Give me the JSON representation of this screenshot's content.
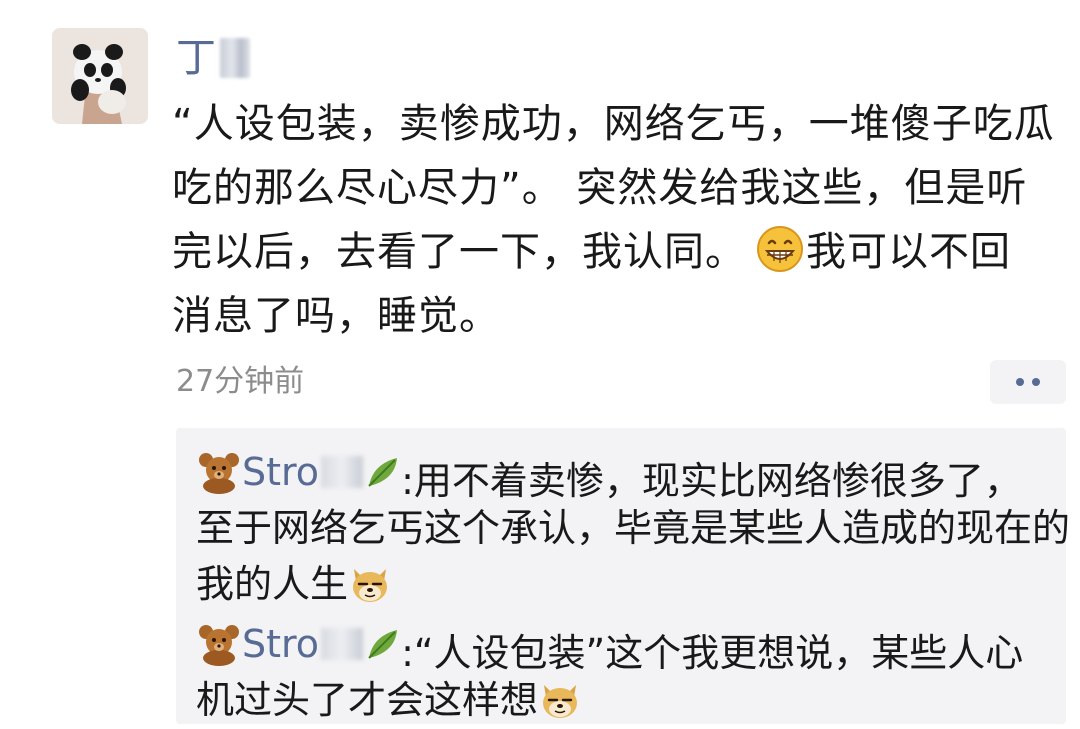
{
  "post": {
    "author": "丁",
    "lines": [
      "“人设包装，卖惨成功，网络乞丐，一堆傻子吃瓜",
      "吃的那么尽心尽力”。 突然发给我这些，但是听",
      "完以后，去看了一下，我认同。",
      "我可以不回",
      "消息了吗，睡觉。"
    ],
    "timestamp": "27分钟前",
    "avatar_icon": "panda-avatar-icon",
    "inline_emoji": "grin-emoji-icon"
  },
  "comments": [
    {
      "author": "Stro",
      "separator": ":",
      "lines": [
        "用不着卖惨，现实比网络惨很多了，",
        "至于网络乞丐这个承认，毕竟是某些人造成的现在的",
        "我的人生"
      ],
      "icons": [
        "bear-icon",
        "leaf-icon",
        "doge-icon"
      ]
    },
    {
      "author": "Stro",
      "separator": ":",
      "lines": [
        "“人设包装”这个我更想说，某些人心",
        "机过头了才会这样想"
      ],
      "icons": [
        "bear-icon",
        "leaf-icon",
        "doge-icon"
      ]
    }
  ],
  "colors": {
    "link": "#576b95",
    "text": "#191919",
    "time": "#8c8c8c",
    "comment_bg": "#f3f3f5"
  }
}
